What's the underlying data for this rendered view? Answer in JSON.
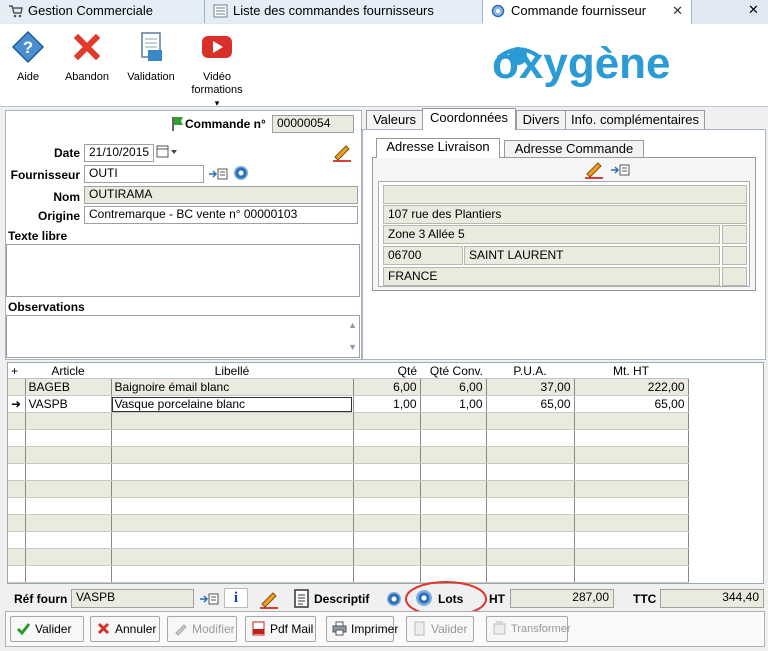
{
  "tabs": [
    {
      "label": "Gestion Commerciale",
      "icon": "cart-icon"
    },
    {
      "label": "Liste des commandes fournisseurs",
      "icon": "list-icon"
    },
    {
      "label": "Commande fournisseur",
      "icon": "gear-doc-icon",
      "close": "✕"
    }
  ],
  "window": {
    "close": "✕"
  },
  "toolbar": {
    "help": "Aide",
    "abandon": "Abandon",
    "validation": "Validation",
    "video_1": "Vidéo",
    "video_2": "formations",
    "video_arrow": "▾"
  },
  "logo": {
    "text": "oxygène"
  },
  "form": {
    "order_label": "Commande n°",
    "order_number": "00000054",
    "date_label": "Date",
    "date_value": "21/10/2015",
    "supplier_label": "Fournisseur",
    "supplier_value": "OUTI",
    "name_label": "Nom",
    "name_value": "OUTIRAMA",
    "origin_label": "Origine",
    "origin_value": "Contremarque - BC vente n° 00000103",
    "free_text_label": "Texte libre",
    "observations_label": "Observations"
  },
  "detail_tabs": [
    "Valeurs",
    "Coordonnées",
    "Divers",
    "Info. complémentaires"
  ],
  "address_tabs": [
    "Adresse Livraison",
    "Adresse Commande"
  ],
  "address": {
    "line0": "",
    "line1": "107 rue des Plantiers",
    "line2": "Zone 3  Allée 5",
    "postcode": "06700",
    "city": "SAINT LAURENT",
    "country": "FRANCE"
  },
  "grid": {
    "columns": [
      "Article",
      "Libellé",
      "Qté",
      "Qté Conv.",
      "P.U.A.",
      "Mt. HT"
    ],
    "rows": [
      {
        "marker": "",
        "article": "BAGEB",
        "libelle": "Baignoire émail blanc",
        "qte": "6,00",
        "qte_conv": "6,00",
        "pua": "37,00",
        "mt_ht": "222,00"
      },
      {
        "marker": "➜",
        "article": "VASPB",
        "libelle": "Vasque porcelaine blanc",
        "qte": "1,00",
        "qte_conv": "1,00",
        "pua": "65,00",
        "mt_ht": "65,00"
      }
    ]
  },
  "footer": {
    "ref_label": "Réf fourn",
    "ref_value": "VASPB",
    "descriptif": "Descriptif",
    "lots": "Lots",
    "ht_label": "HT",
    "ht_value": "287,00",
    "ttc_label": "TTC",
    "ttc_value": "344,40"
  },
  "buttons": {
    "valider": "Valider",
    "annuler": "Annuler",
    "modifier": "Modifier",
    "pdf_mail": "Pdf Mail",
    "imprimer": "Imprimer",
    "valider2": "Valider",
    "transformer": "Transformer"
  },
  "colors": {
    "brand": "#2b9bd6",
    "highlight_circle": "#e0332a",
    "readonly_bg": "#ebeade"
  }
}
